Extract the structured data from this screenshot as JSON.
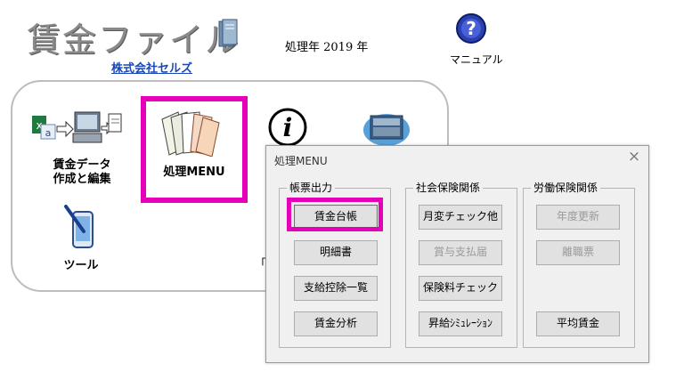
{
  "header": {
    "app_title": "賃金ファイル",
    "company_link": "株式会社セルズ",
    "year_label": "処理年 2019 年",
    "manual_label": "マニュアル"
  },
  "main_menu": {
    "tiles": [
      {
        "label_line1": "賃金データ",
        "label_line2": "作成と編集"
      },
      {
        "label": "処理MENU"
      },
      {
        "label": "ツール"
      }
    ],
    "partial_text": "「"
  },
  "dialog": {
    "title": "処理MENU",
    "close": "×",
    "groups": [
      {
        "legend": "帳票出力",
        "buttons": [
          "賃金台帳",
          "明細書",
          "支給控除一覧",
          "賃金分析"
        ]
      },
      {
        "legend": "社会保険関係",
        "buttons": [
          "月変チェック他",
          "賞与支払届",
          "保険料チェック",
          "昇給ｼﾐｭﾚｰｼｮﾝ"
        ]
      },
      {
        "legend": "労働保険関係",
        "buttons": [
          "年度更新",
          "離職票",
          "平均賃金"
        ]
      }
    ]
  },
  "icons": {
    "app_logo": "document-file-icon",
    "manual": "help-question-icon",
    "data_edit": "excel-to-computer-icon",
    "process_menu": "book-stack-icon",
    "info": "info-icon",
    "database": "file-cabinet-icon",
    "tool": "phone-pen-icon"
  },
  "colors": {
    "highlight": "#e600b8",
    "company_link": "#1a47b8",
    "manual_icon": "#2a3fb0"
  }
}
